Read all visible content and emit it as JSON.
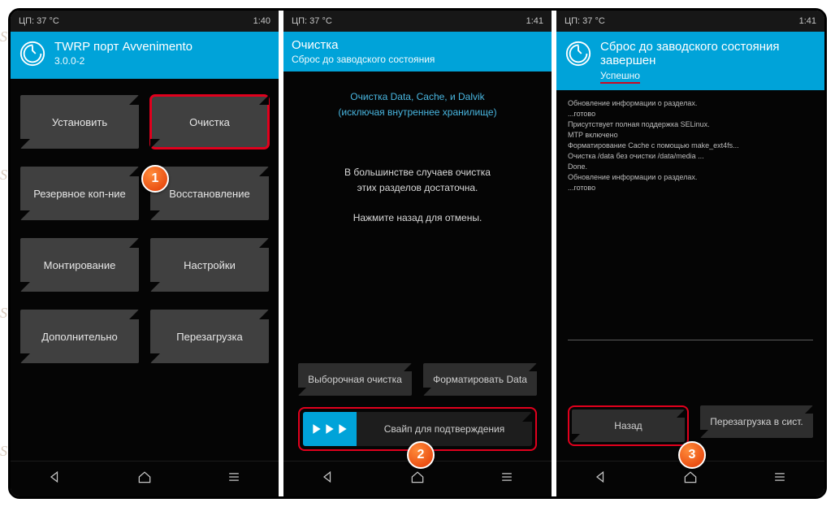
{
  "watermarks": [
    "Soringpergpeir.Com",
    "Soringpergpeir.Com",
    "Soringpergpeir.Com",
    "Soringpergpeir.Com"
  ],
  "markers": {
    "m1": "1",
    "m2": "2",
    "m3": "3"
  },
  "screen1": {
    "status": {
      "left": "ЦП: 37 °C",
      "right": "1:40"
    },
    "header": {
      "title": "TWRP порт Avvenimento",
      "sub": "3.0.0-2"
    },
    "buttons": {
      "install": "Установить",
      "wipe": "Очистка",
      "backup": "Резервное коп-ние",
      "restore": "Восстановление",
      "mount": "Монтирование",
      "settings": "Настройки",
      "advanced": "Дополнительно",
      "reboot": "Перезагрузка"
    }
  },
  "screen2": {
    "status": {
      "left": "ЦП: 37 °C",
      "right": "1:41"
    },
    "header": {
      "title": "Очистка",
      "sub": "Сброс до заводского состояния"
    },
    "link1": "Очистка Data, Cache, и Dalvik",
    "link2": "(исключая внутреннее хранилище)",
    "note1": "В большинстве случаев очистка",
    "note2": "этих разделов достаточна.",
    "note3": "Нажмите назад для отмены.",
    "btn_advanced_wipe": "Выборочная очистка",
    "btn_format_data": "Форматировать Data",
    "swipe_label": "Свайп для подтверждения"
  },
  "screen3": {
    "status": {
      "left": "ЦП: 37 °C",
      "right": "1:41"
    },
    "header": {
      "title": "Сброс до заводского состояния завершен",
      "status": "Успешно"
    },
    "log_lines": [
      "Обновление информации о разделах.",
      "...готово",
      "Присутствует полная поддержка SELinux.",
      "MTP включено",
      "Форматирование Cache с помощью make_ext4fs...",
      "Очистка /data без очистки /data/media ...",
      "Done.",
      "Обновление информации о разделах.",
      "...готово"
    ],
    "btn_back": "Назад",
    "btn_reboot": "Перезагрузка в сист."
  }
}
